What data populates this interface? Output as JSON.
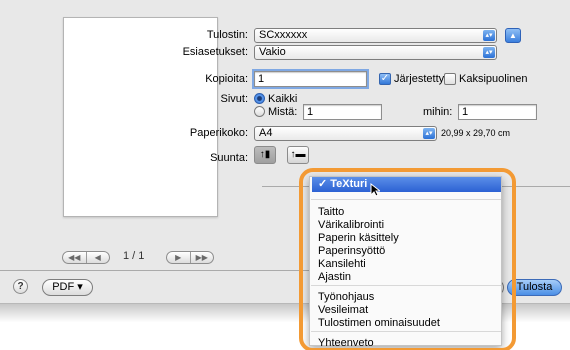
{
  "colors": {
    "highlight": "#f39a34",
    "menu_selection": "#2c61d3",
    "accent_blue": "#3a7fdd"
  },
  "printer": {
    "label": "Tulostin:",
    "value": "SCxxxxxx",
    "disclosure_icon": "triangle-up-icon"
  },
  "presets": {
    "label": "Esiasetukset:",
    "value": "Vakio"
  },
  "copies": {
    "label": "Kopioita:",
    "value": "1",
    "collated_label": "Järjestetty",
    "collated_checked": true,
    "duplex_label": "Kaksipuolinen",
    "duplex_checked": false
  },
  "pages": {
    "label": "Sivut:",
    "all_label": "Kaikki",
    "from_label": "Mistä:",
    "from_value": "1",
    "to_label": "mihin:",
    "to_value": "1",
    "selected": "Kaikki"
  },
  "paper": {
    "label": "Paperikoko:",
    "value": "A4",
    "dimensions": "20,99 x 29,70 cm"
  },
  "orientation": {
    "label": "Suunta:",
    "portrait_icon": "portrait-orientation-icon",
    "landscape_icon": "landscape-orientation-icon",
    "selected": "portrait"
  },
  "preview": {
    "page_indicator": "1 / 1",
    "first_icon": "double-left-arrow-icon",
    "prev_icon": "left-arrow-icon",
    "next_icon": "right-arrow-icon",
    "last_icon": "double-right-arrow-icon"
  },
  "footer": {
    "help_label": "?",
    "pdf_label": "PDF ▾",
    "print_label": "Tulosta"
  },
  "menu": {
    "selected": "✓ TeXturi",
    "group1": [
      "Taitto",
      "Värikalibrointi",
      "Paperin käsittely",
      "Paperinsyöttö",
      "Kansilehti",
      "Ajastin"
    ],
    "group2": [
      "Työnohjaus",
      "Vesileimat",
      "Tulostimen ominaisuudet"
    ],
    "group3": [
      "Yhteenveto"
    ]
  }
}
